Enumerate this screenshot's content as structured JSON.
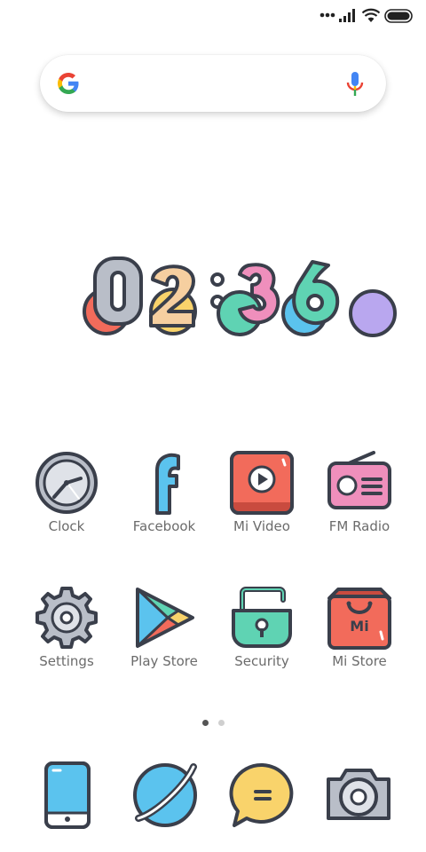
{
  "status_bar": {
    "icons": [
      "more-dots-icon",
      "signal-icon",
      "wifi-icon",
      "battery-icon"
    ]
  },
  "search_bar": {
    "icons": [
      "google-g-icon",
      "mic-icon"
    ]
  },
  "clock_widget": {
    "time": "02:36",
    "digits": [
      "0",
      "2",
      ":",
      "3",
      "6"
    ]
  },
  "apps_row1": [
    {
      "label": "Clock",
      "icon": "clock-icon"
    },
    {
      "label": "Facebook",
      "icon": "facebook-icon"
    },
    {
      "label": "Mi Video",
      "icon": "play-video-icon"
    },
    {
      "label": "FM Radio",
      "icon": "radio-icon"
    }
  ],
  "apps_row2": [
    {
      "label": "Settings",
      "icon": "gear-icon"
    },
    {
      "label": "Play Store",
      "icon": "play-store-icon"
    },
    {
      "label": "Security",
      "icon": "padlock-icon"
    },
    {
      "label": "Mi Store",
      "icon": "shopping-bag-icon",
      "badge": "Mi"
    }
  ],
  "pager": {
    "pages": 2,
    "active": 1
  },
  "dock": [
    {
      "icon": "phone-icon"
    },
    {
      "icon": "browser-icon"
    },
    {
      "icon": "messages-icon"
    },
    {
      "icon": "camera-icon"
    }
  ],
  "colors": {
    "outline": "#3a3f4b",
    "red": "#f26b5b",
    "pink": "#ef8fbc",
    "teal": "#5fd3b3",
    "blue": "#5bc3ee",
    "yellow": "#f9d36b",
    "purple": "#b9a7ef",
    "grey": "#b9bec8"
  }
}
